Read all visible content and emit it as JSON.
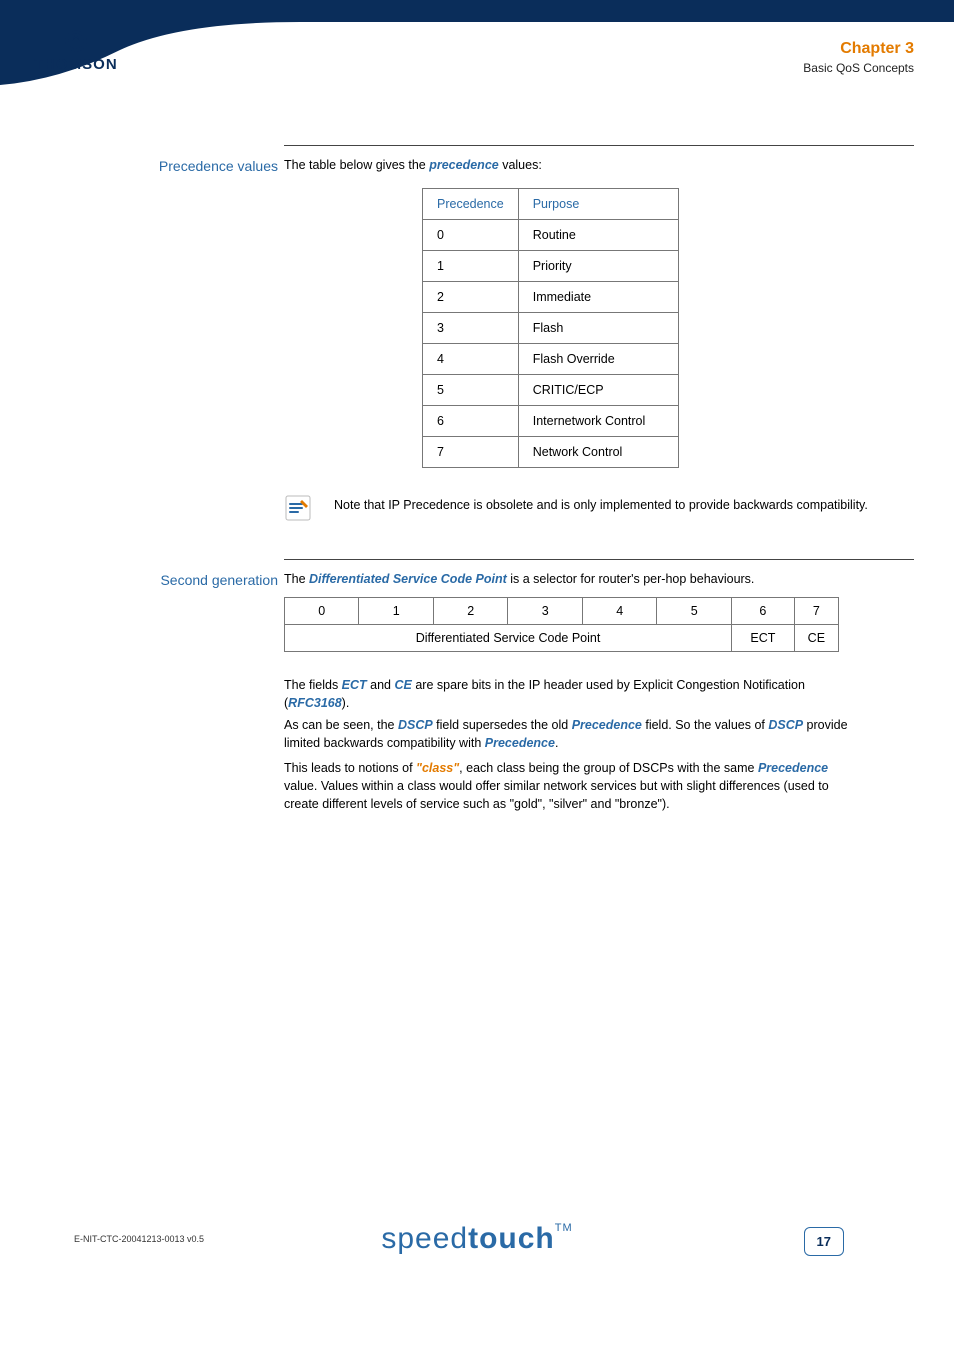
{
  "header": {
    "brand": "THOMSON",
    "chapter_label": "Chapter 3",
    "chapter_subtitle": "Basic QoS Concepts"
  },
  "section1": {
    "sidelabel": "Precedence values",
    "intro_pre": "The table below gives the ",
    "intro_bold": "precedence",
    "intro_post": " values:"
  },
  "prec_table": {
    "headers": [
      "Precedence",
      "Purpose"
    ],
    "rows": [
      {
        "p": "0",
        "purpose": "Routine"
      },
      {
        "p": "1",
        "purpose": "Priority"
      },
      {
        "p": "2",
        "purpose": "Immediate"
      },
      {
        "p": "3",
        "purpose": "Flash"
      },
      {
        "p": "4",
        "purpose": "Flash Override"
      },
      {
        "p": "5",
        "purpose": "CRITIC/ECP"
      },
      {
        "p": "6",
        "purpose": "Internetwork Control"
      },
      {
        "p": "7",
        "purpose": "Network Control"
      }
    ]
  },
  "note": {
    "text": "Note that IP Precedence is obsolete and is only implemented to provide backwards compatibility."
  },
  "section2": {
    "sidelabel": "Second generation",
    "intro_pre": "The ",
    "intro_bold": "Differentiated Service Code Point",
    "intro_post": " is a selector for router's per-hop behaviours."
  },
  "dscp_table": {
    "bits": [
      "0",
      "1",
      "2",
      "3",
      "4",
      "5",
      "6",
      "7"
    ],
    "row2": {
      "label": "Differentiated Service Code Point",
      "c6": "ECT",
      "c7": "CE"
    }
  },
  "para1": {
    "t1": "The fields ",
    "b1": "ECT",
    "t2": " and ",
    "b2": "CE",
    "t3": " are spare bits in the IP header used by Explicit Congestion Notification (",
    "b3": "RFC3168",
    "t4": ")."
  },
  "para2": {
    "t1": "As can be seen, the ",
    "b1": "DSCP",
    "t2": " field supersedes the old ",
    "b2": "Precedence",
    "t3": " field. So the values of ",
    "b3": "DSCP",
    "t4": " provide limited backwards compatibility with ",
    "b4": "Precedence",
    "t5": "."
  },
  "para3": {
    "t1": "This leads to notions of ",
    "b1": "\"class\"",
    "t2": ", each class being the group of DSCPs with the same ",
    "b2": "Precedence",
    "t3": " value. Values within a class would offer similar network services but with slight differences (used to create different levels of service such as \"gold\", \"silver\" and \"bronze\")."
  },
  "footer": {
    "docid": "E-NIT-CTC-20041213-0013 v0.5",
    "brand_pre": "speed",
    "brand_bold": "touch",
    "tm": "TM",
    "page": "17"
  }
}
